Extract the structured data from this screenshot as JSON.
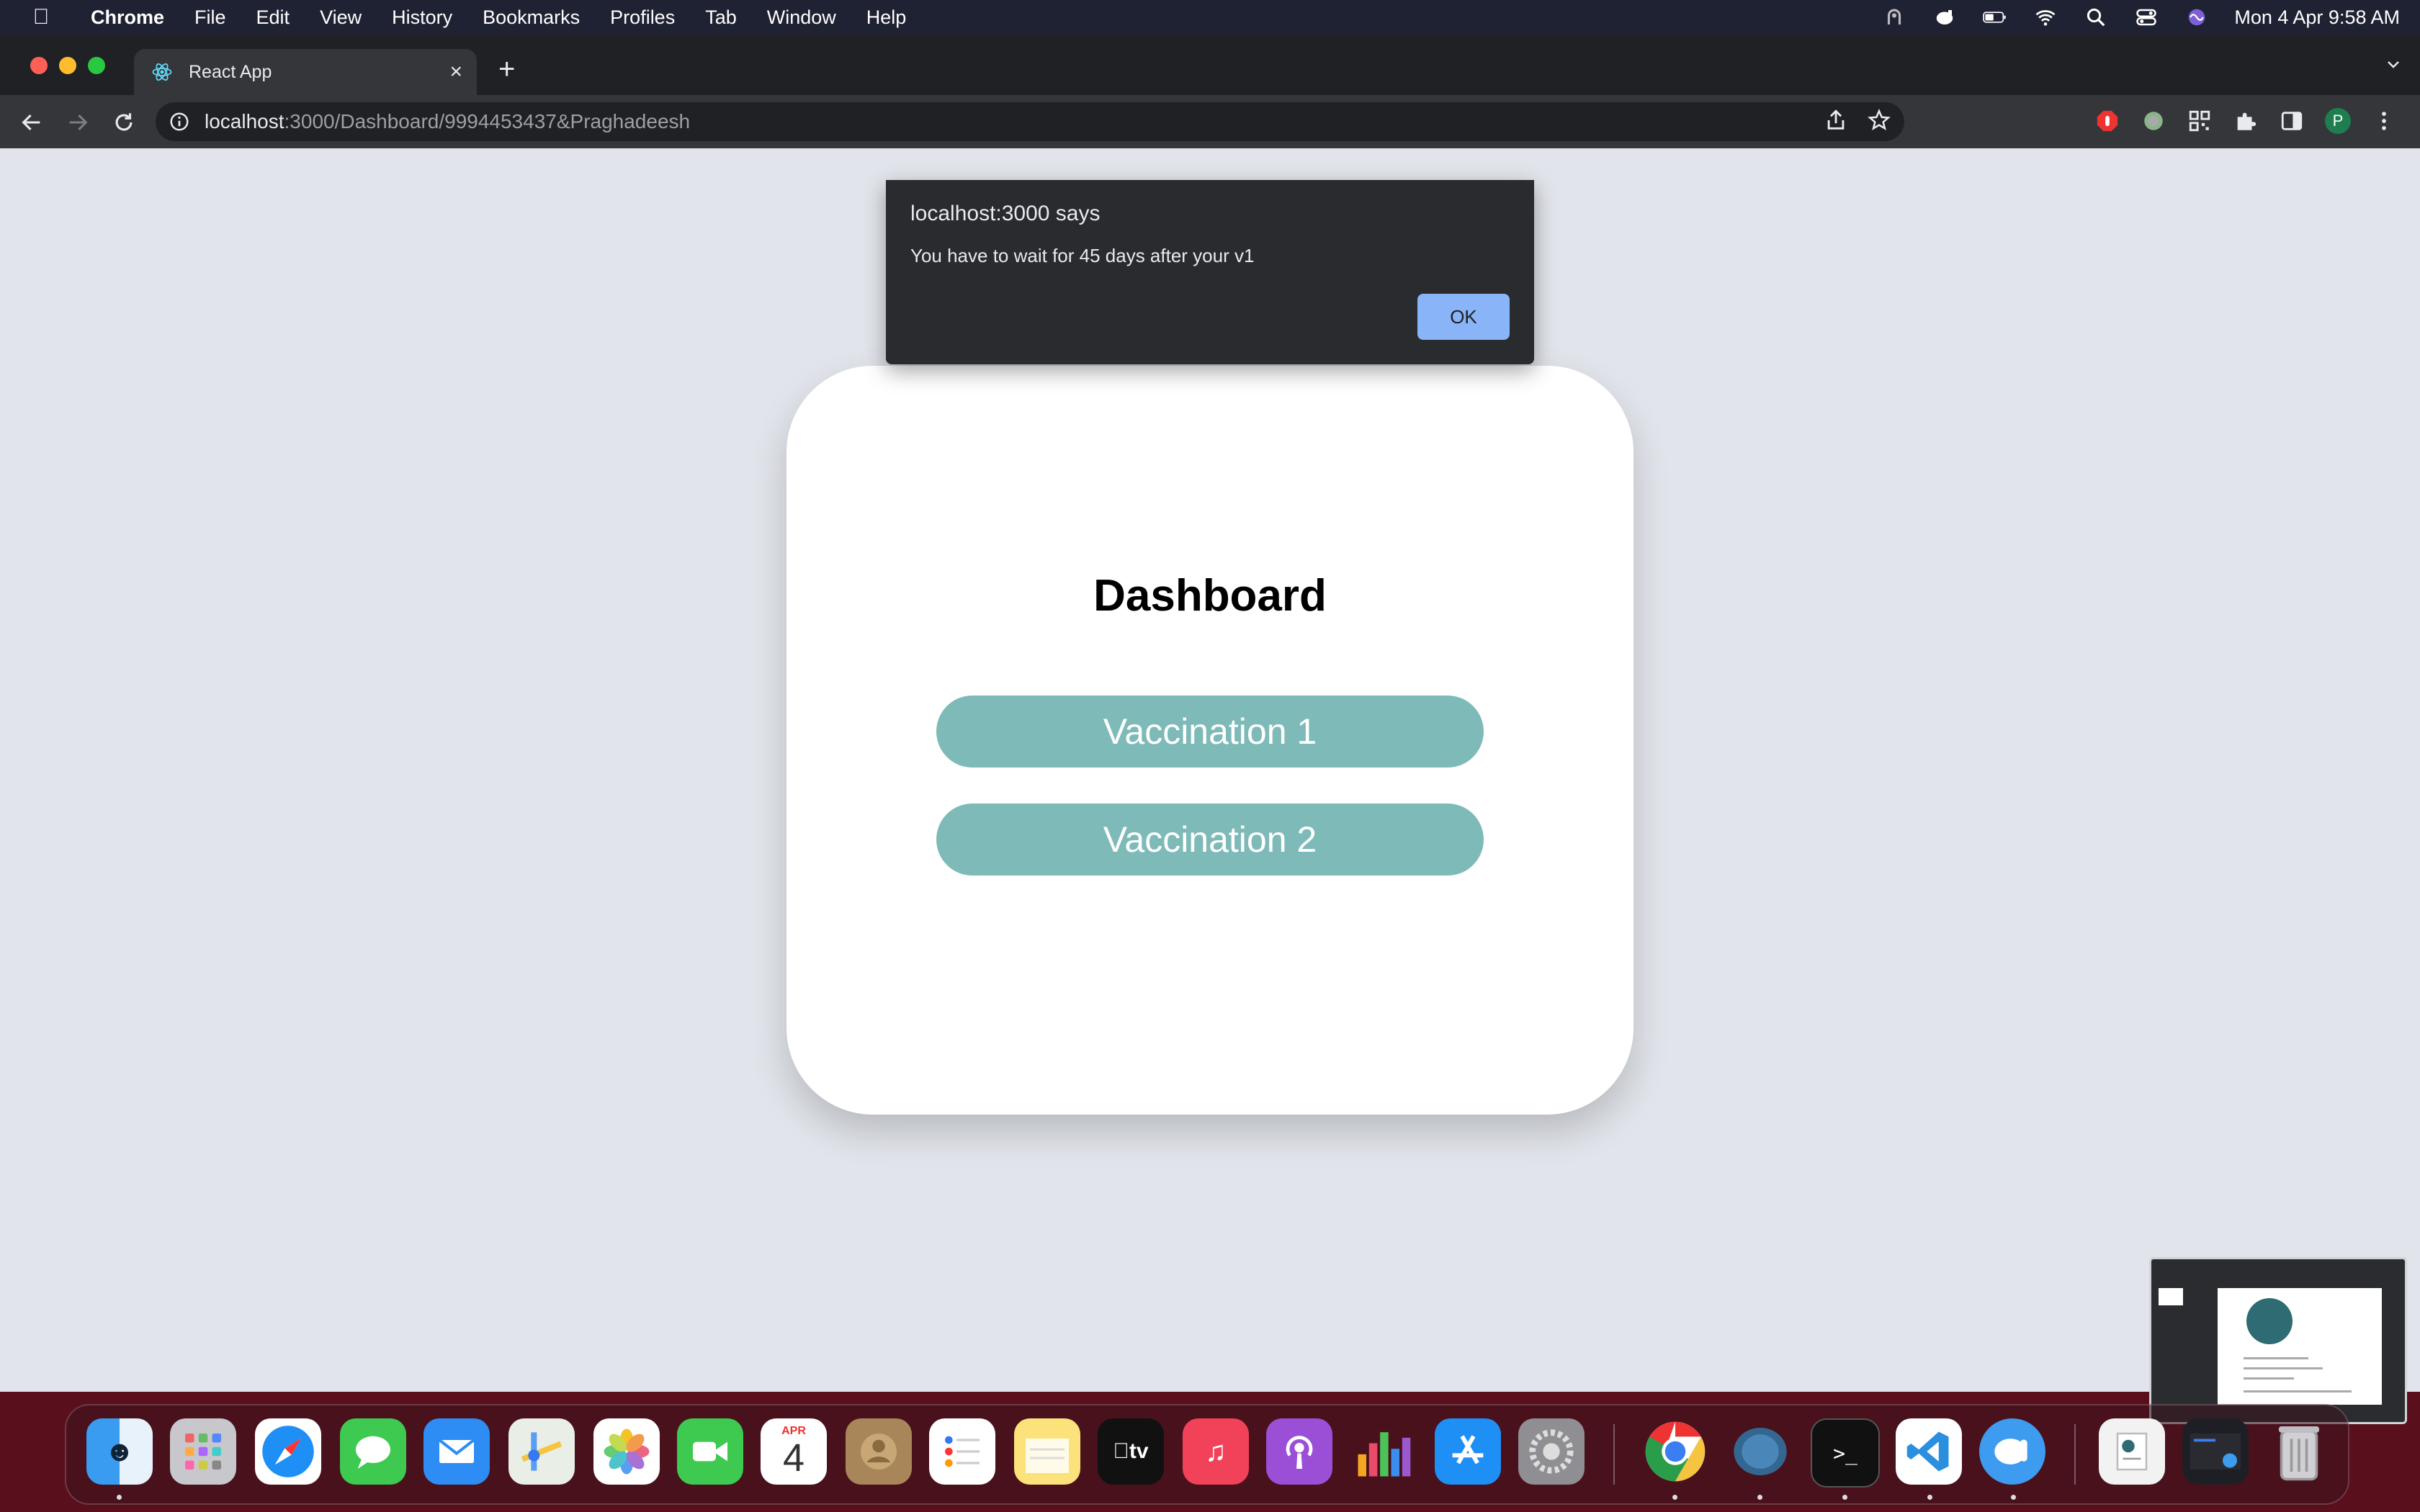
{
  "menubar": {
    "app_name": "Chrome",
    "menus": [
      "File",
      "Edit",
      "View",
      "History",
      "Bookmarks",
      "Profiles",
      "Tab",
      "Window",
      "Help"
    ],
    "clock": "Mon 4 Apr  9:58 AM"
  },
  "browser": {
    "tab_title": "React App",
    "url_host": "localhost",
    "url_path": ":3000/Dashboard/9994453437&Praghadeesh",
    "profile_initial": "P"
  },
  "dialog": {
    "title": "localhost:3000 says",
    "message": "You have to wait for 45 days after your v1",
    "ok_label": "OK"
  },
  "dashboard": {
    "title": "Dashboard",
    "buttons": [
      "Vaccination 1",
      "Vaccination 2"
    ]
  },
  "dock": {
    "calendar_month": "APR",
    "calendar_day": "4",
    "apps": [
      "finder",
      "launchpad",
      "safari",
      "messages",
      "mail",
      "maps",
      "photos",
      "facetime",
      "calendar",
      "contacts",
      "reminders",
      "notes",
      "tv",
      "music",
      "podcasts",
      "numbers",
      "app-store",
      "system-preferences",
      "chrome",
      "pgadmin",
      "terminal",
      "vscode",
      "tableplus",
      "pdf-document",
      "screenshot",
      "trash"
    ]
  },
  "colors": {
    "accent_button": "#7ebab8",
    "dialog_ok": "#8ab4f8",
    "page_background": "#e1e4ea"
  }
}
